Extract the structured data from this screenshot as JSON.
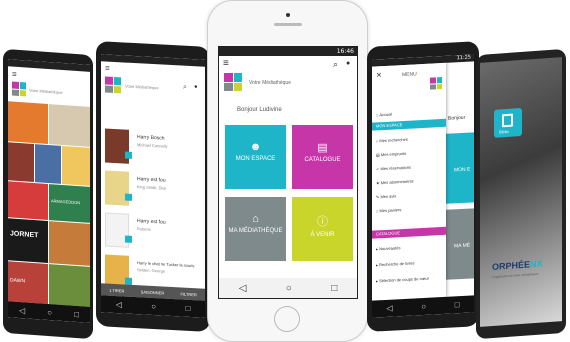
{
  "colors": {
    "cyan": "#1fb5c9",
    "magenta": "#c636a9",
    "gray": "#7f8a8d",
    "lime": "#c9d52a",
    "orange": "#f08a1e",
    "logo_yellow": "#f5b21e"
  },
  "status": {
    "time_center": "16:46",
    "time_right": "11:25"
  },
  "app": {
    "title_small": "Votre Médiathèque",
    "greeting": "Bonjour Ludivine"
  },
  "tiles": [
    {
      "label": "MON ESPACE",
      "icon": "user-icon"
    },
    {
      "label": "CATALOGUE",
      "icon": "book-icon"
    },
    {
      "label": "MA MÉDIATHÈQUE",
      "icon": "home-icon"
    },
    {
      "label": "À VENIR",
      "icon": "info-icon"
    }
  ],
  "books": [
    {
      "title": "Harry Bosch",
      "author": "Michael Connelly"
    },
    {
      "title": "Harry est fou",
      "author": "King Smith, Dick"
    },
    {
      "title": "Harry est fou",
      "author": "Rubens"
    },
    {
      "title": "Harry le chat ne Tucker la souris",
      "author": "Selden, George"
    }
  ],
  "book_tabs": [
    "1 TIRER",
    "SAISONNER",
    "FILTRER"
  ],
  "menu": {
    "title": "MENU",
    "section1": "MON ESPACE",
    "items1": [
      "Accueil",
      "Mes recherches",
      "Mes emprunts",
      "Mes réservations",
      "Mes abonnements",
      "Mes avis",
      "Mes paniers"
    ],
    "section2": "CATALOGUE",
    "items2": [
      "Nouveautés",
      "Recherche de livres",
      "Sélection de coups de cœur"
    ],
    "partial_tile_top": "MON E",
    "partial_tile_bottom": "MA MÉ",
    "partial_greeting": "Bonjour"
  },
  "left_screen": {
    "header": "Votre Médiathèque",
    "poster1": "JORNET",
    "poster2": "ARMAGEDDON",
    "poster3": "DAWN"
  },
  "brand": {
    "name": "ORPHÉE",
    "suffix": "NX",
    "tile_label": "Biblio",
    "tagline": "L'application de votre médiathèque"
  },
  "nav_glyphs": [
    "◁",
    "○",
    "□"
  ]
}
